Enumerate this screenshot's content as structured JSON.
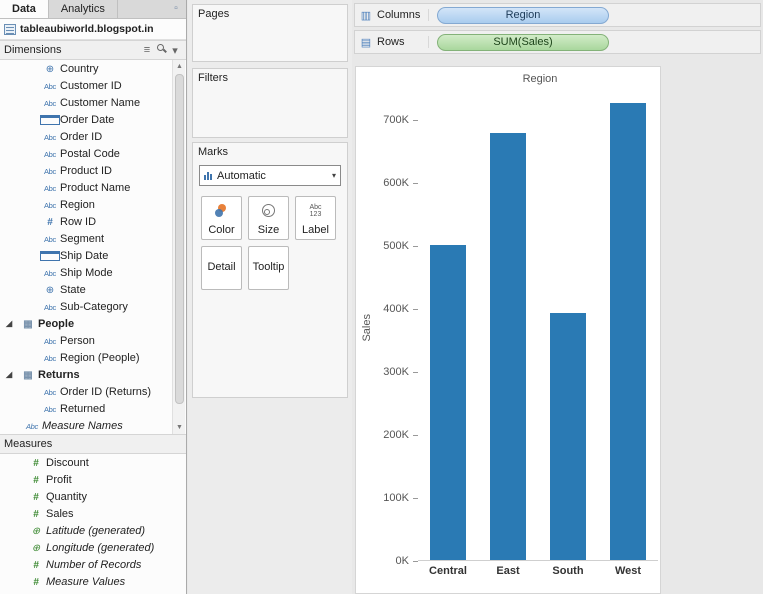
{
  "left_pane": {
    "tabs": [
      {
        "label": "Data"
      },
      {
        "label": "Analytics"
      }
    ],
    "datasource": {
      "label": "tableaubiworld.blogspot.in"
    },
    "dimensions": {
      "header": "Dimensions",
      "items": [
        {
          "icon": "globe",
          "label": "Country"
        },
        {
          "icon": "abc",
          "label": "Customer ID"
        },
        {
          "icon": "abc",
          "label": "Customer Name"
        },
        {
          "icon": "cal",
          "label": "Order Date"
        },
        {
          "icon": "abc",
          "label": "Order ID"
        },
        {
          "icon": "abc",
          "label": "Postal Code"
        },
        {
          "icon": "abc",
          "label": "Product ID"
        },
        {
          "icon": "abc",
          "label": "Product Name"
        },
        {
          "icon": "abc",
          "label": "Region"
        },
        {
          "icon": "hash",
          "label": "Row ID"
        },
        {
          "icon": "abc",
          "label": "Segment"
        },
        {
          "icon": "cal",
          "label": "Ship Date"
        },
        {
          "icon": "abc",
          "label": "Ship Mode"
        },
        {
          "icon": "globe",
          "label": "State"
        },
        {
          "icon": "abc",
          "label": "Sub-Category"
        },
        {
          "icon": "grid",
          "label": "People"
        },
        {
          "icon": "abc",
          "label": "Person"
        },
        {
          "icon": "abc",
          "label": "Region (People)"
        },
        {
          "icon": "grid",
          "label": "Returns"
        },
        {
          "icon": "abc",
          "label": "Order ID (Returns)"
        },
        {
          "icon": "abc",
          "label": "Returned"
        },
        {
          "icon": "abc",
          "label": "Measure Names"
        }
      ]
    },
    "measures": {
      "header": "Measures",
      "items": [
        {
          "icon": "hash",
          "label": "Discount"
        },
        {
          "icon": "hash",
          "label": "Profit"
        },
        {
          "icon": "hash",
          "label": "Quantity"
        },
        {
          "icon": "hash",
          "label": "Sales"
        },
        {
          "icon": "globe",
          "label": "Latitude (generated)"
        },
        {
          "icon": "globe",
          "label": "Longitude (generated)"
        },
        {
          "icon": "hash",
          "label": "Number of Records"
        },
        {
          "icon": "hash",
          "label": "Measure Values"
        }
      ]
    }
  },
  "cards": {
    "pages": {
      "title": "Pages"
    },
    "filters": {
      "title": "Filters"
    },
    "marks": {
      "title": "Marks",
      "mark_type": "Automatic",
      "buttons": [
        {
          "label": "Color"
        },
        {
          "label": "Size"
        },
        {
          "label": "Label"
        },
        {
          "label": "Detail"
        },
        {
          "label": "Tooltip"
        }
      ]
    }
  },
  "shelves": {
    "columns": {
      "label": "Columns",
      "pill": "Region"
    },
    "rows": {
      "label": "Rows",
      "pill": "SUM(Sales)"
    }
  },
  "chart_data": {
    "type": "bar",
    "title": "Region",
    "categories": [
      "Central",
      "East",
      "South",
      "West"
    ],
    "values": [
      501,
      678,
      392,
      725
    ],
    "value_unit": "K",
    "xlabel": "",
    "ylabel": "Sales",
    "yticks": [
      0,
      100,
      200,
      300,
      400,
      500,
      600,
      700
    ],
    "ytick_labels": [
      "0K",
      "100K",
      "200K",
      "300K",
      "400K",
      "500K",
      "600K",
      "700K"
    ],
    "ylim": [
      0,
      740
    ],
    "grid": false,
    "legend": "none",
    "bar_color": "#2a7ab4"
  },
  "colors": {
    "bar": "#2a7ab4",
    "dimension_accent": "#3f74ad",
    "measure_accent": "#3d8a33",
    "columns_pill_bg": "#a9ccee",
    "rows_pill_bg": "#a9d79d"
  }
}
